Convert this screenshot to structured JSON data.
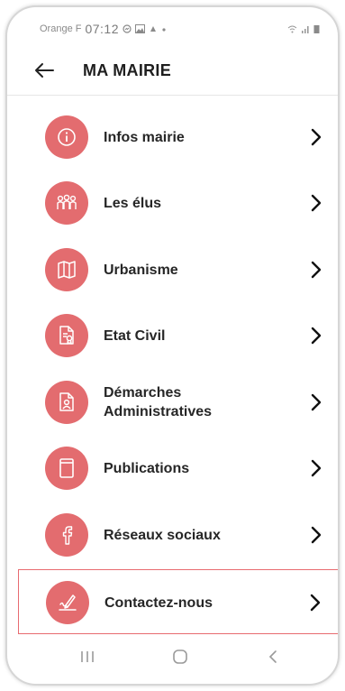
{
  "status": {
    "carrier": "Orange F",
    "time": "07:12"
  },
  "header": {
    "title": "MA MAIRIE"
  },
  "menu": {
    "items": [
      {
        "label": "Infos mairie",
        "icon": "info-icon"
      },
      {
        "label": "Les élus",
        "icon": "people-icon"
      },
      {
        "label": "Urbanisme",
        "icon": "map-icon"
      },
      {
        "label": "Etat Civil",
        "icon": "document-badge-icon"
      },
      {
        "label": "Démarches\nAdministratives",
        "icon": "document-person-icon"
      },
      {
        "label": "Publications",
        "icon": "document-icon"
      },
      {
        "label": "Réseaux sociaux",
        "icon": "facebook-icon"
      },
      {
        "label": "Contactez-nous",
        "icon": "signature-icon"
      }
    ],
    "highlighted_item": "Contactez-nous"
  },
  "colors": {
    "accent": "#e36c6f",
    "highlight_border": "#e86b70"
  }
}
